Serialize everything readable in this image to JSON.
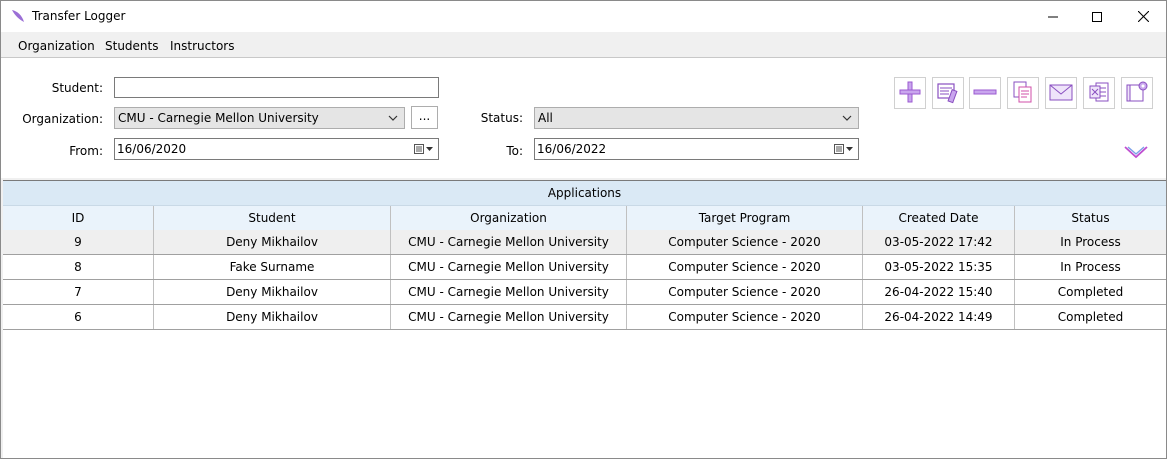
{
  "window": {
    "title": "Transfer Logger"
  },
  "menu": {
    "items": [
      "Organization",
      "Students",
      "Instructors"
    ]
  },
  "filters": {
    "student_label": "Student:",
    "student_value": "",
    "organization_label": "Organization:",
    "organization_value": "CMU - Carnegie Mellon University",
    "browse_label": "...",
    "from_label": "From:",
    "from_value": "16/06/2020",
    "status_label": "Status:",
    "status_value": "All",
    "to_label": "To:",
    "to_value": "16/06/2022"
  },
  "toolbar": {
    "icons": [
      "add-icon",
      "edit-icon",
      "remove-icon",
      "copy-icon",
      "email-icon",
      "excel-export-icon",
      "settings-icon",
      "expand-chevron-icon"
    ]
  },
  "colors": {
    "accent": "#c04fd0",
    "header_bg": "#dae9f5"
  },
  "grid": {
    "caption": "Applications",
    "columns": [
      "ID",
      "Student",
      "Organization",
      "Target Program",
      "Created Date",
      "Status"
    ],
    "rows": [
      [
        "9",
        "Deny Mikhailov",
        "CMU - Carnegie Mellon University",
        "Computer Science - 2020",
        "03-05-2022 17:42",
        "In Process"
      ],
      [
        "8",
        "Fake Surname",
        "CMU - Carnegie Mellon University",
        "Computer Science - 2020",
        "03-05-2022 15:35",
        "In Process"
      ],
      [
        "7",
        "Deny Mikhailov",
        "CMU - Carnegie Mellon University",
        "Computer Science - 2020",
        "26-04-2022 15:40",
        "Completed"
      ],
      [
        "6",
        "Deny Mikhailov",
        "CMU - Carnegie Mellon University",
        "Computer Science - 2020",
        "26-04-2022 14:49",
        "Completed"
      ]
    ]
  }
}
